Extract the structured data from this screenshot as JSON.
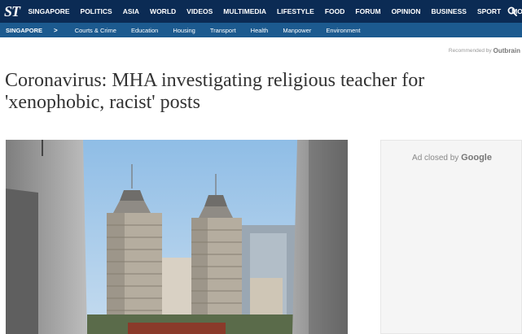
{
  "logo": "ST",
  "nav": {
    "items": [
      "SINGAPORE",
      "POLITICS",
      "ASIA",
      "WORLD",
      "VIDEOS",
      "MULTIMEDIA",
      "LIFESTYLE",
      "FOOD",
      "FORUM",
      "OPINION",
      "BUSINESS",
      "SPORT"
    ],
    "more_label": "MORE"
  },
  "subnav": {
    "section": "SINGAPORE",
    "chevron": ">",
    "items": [
      "Courts & Crime",
      "Education",
      "Housing",
      "Transport",
      "Health",
      "Manpower",
      "Environment"
    ]
  },
  "recommended": {
    "text": "Recommended by",
    "brand": "Outbrain"
  },
  "headline": "Coronavirus: MHA investigating religious teacher for 'xenophobic, racist' posts",
  "ad": {
    "text": "Ad closed by",
    "brand": "Google"
  },
  "colors": {
    "nav_bg": "#0b2b54",
    "subnav_bg": "#1c5a8f"
  }
}
